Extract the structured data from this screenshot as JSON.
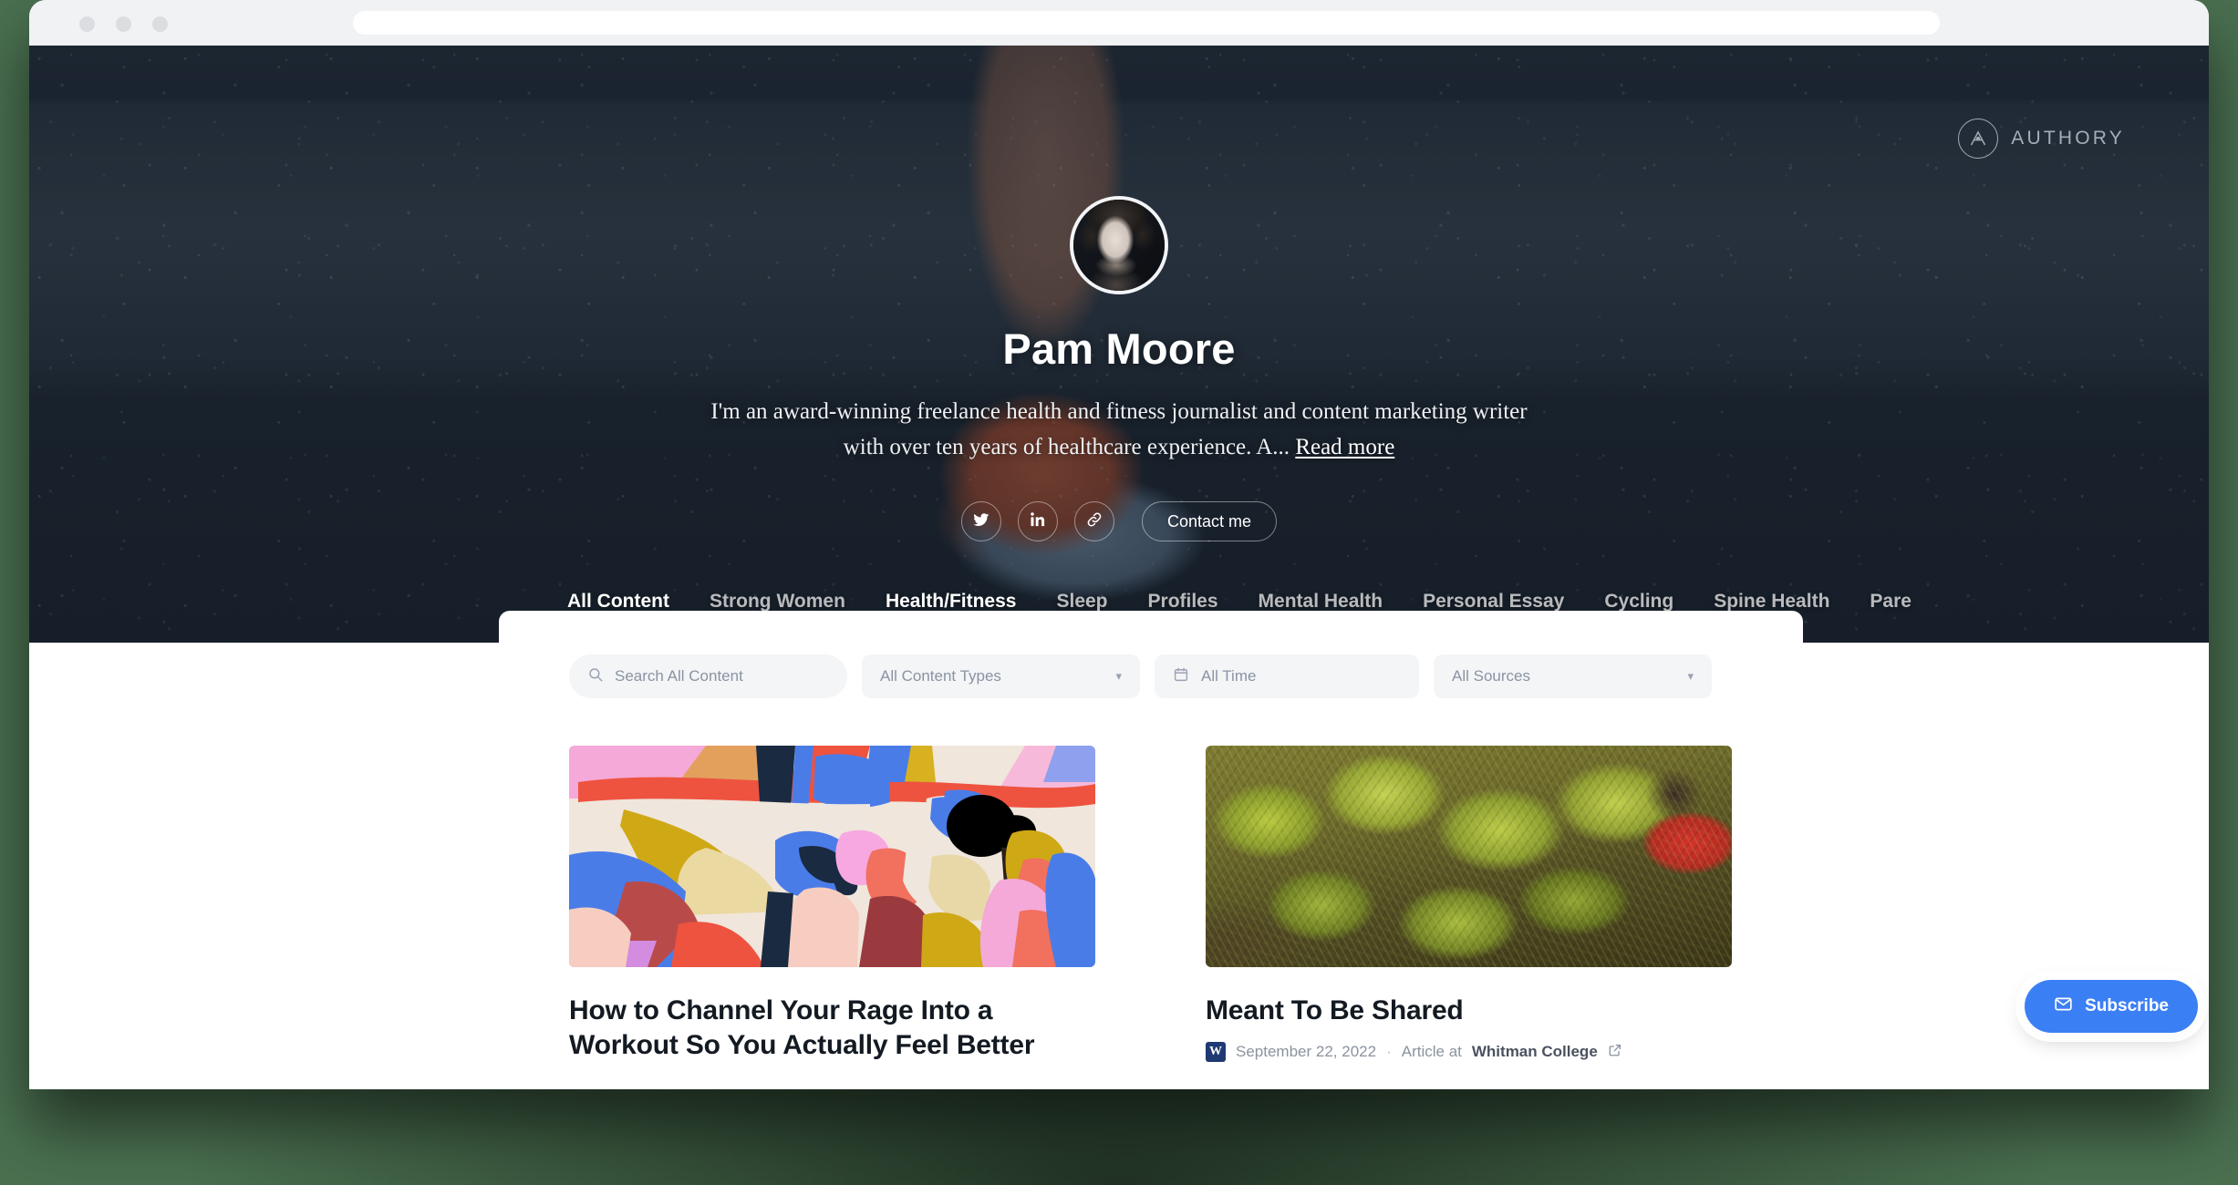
{
  "browser": {
    "traffic_lights": [
      "close",
      "minimize",
      "maximize"
    ],
    "url_value": "",
    "url_placeholder": ""
  },
  "hero": {
    "brand": {
      "name": "AUTHORY",
      "icon": "authory-logo-icon"
    },
    "avatar_alt": "Pam Moore portrait",
    "name": "Pam Moore",
    "bio_text": "I'm an award-winning freelance health and fitness journalist and content marketing writer with over ten years of healthcare experience. A...",
    "read_more_label": "Read more",
    "social": [
      {
        "name": "twitter",
        "icon": "twitter-icon"
      },
      {
        "name": "linkedin",
        "icon": "linkedin-icon"
      },
      {
        "name": "website",
        "icon": "link-icon"
      }
    ],
    "contact_label": "Contact me"
  },
  "tabs": [
    {
      "label": "All Content",
      "state": "active"
    },
    {
      "label": "Strong Women",
      "state": "normal"
    },
    {
      "label": "Health/Fitness",
      "state": "highlight"
    },
    {
      "label": "Sleep",
      "state": "normal"
    },
    {
      "label": "Profiles",
      "state": "normal"
    },
    {
      "label": "Mental Health",
      "state": "normal"
    },
    {
      "label": "Personal Essay",
      "state": "normal"
    },
    {
      "label": "Cycling",
      "state": "normal"
    },
    {
      "label": "Spine Health",
      "state": "normal"
    },
    {
      "label": "Pare",
      "state": "normal"
    }
  ],
  "filters": {
    "search_placeholder": "Search All Content",
    "search_value": "",
    "content_types_label": "All Content Types",
    "time_label": "All Time",
    "sources_label": "All Sources"
  },
  "cards": [
    {
      "title": "How to Channel Your Rage Into a Workout So You Actually Feel Better",
      "image_alt": "Colorful abstract illustration of people exercising",
      "has_meta": false
    },
    {
      "title": "Meant To Be Shared",
      "image_alt": "Agave plants in golden sunlight with a person in a red jacket",
      "has_meta": true,
      "favicon_letter": "W",
      "date": "September 22, 2022",
      "separator": "·",
      "type_prefix": "Article at",
      "source": "Whitman College",
      "external_icon": "external-link-icon"
    }
  ],
  "subscribe": {
    "label": "Subscribe",
    "icon": "envelope-icon"
  },
  "colors": {
    "accent_blue": "#3b7ff5",
    "hero_dark": "#1e2832",
    "panel_white": "#ffffff",
    "backdrop_green": "#4a7050",
    "favicon_navy": "#1f3a73"
  }
}
